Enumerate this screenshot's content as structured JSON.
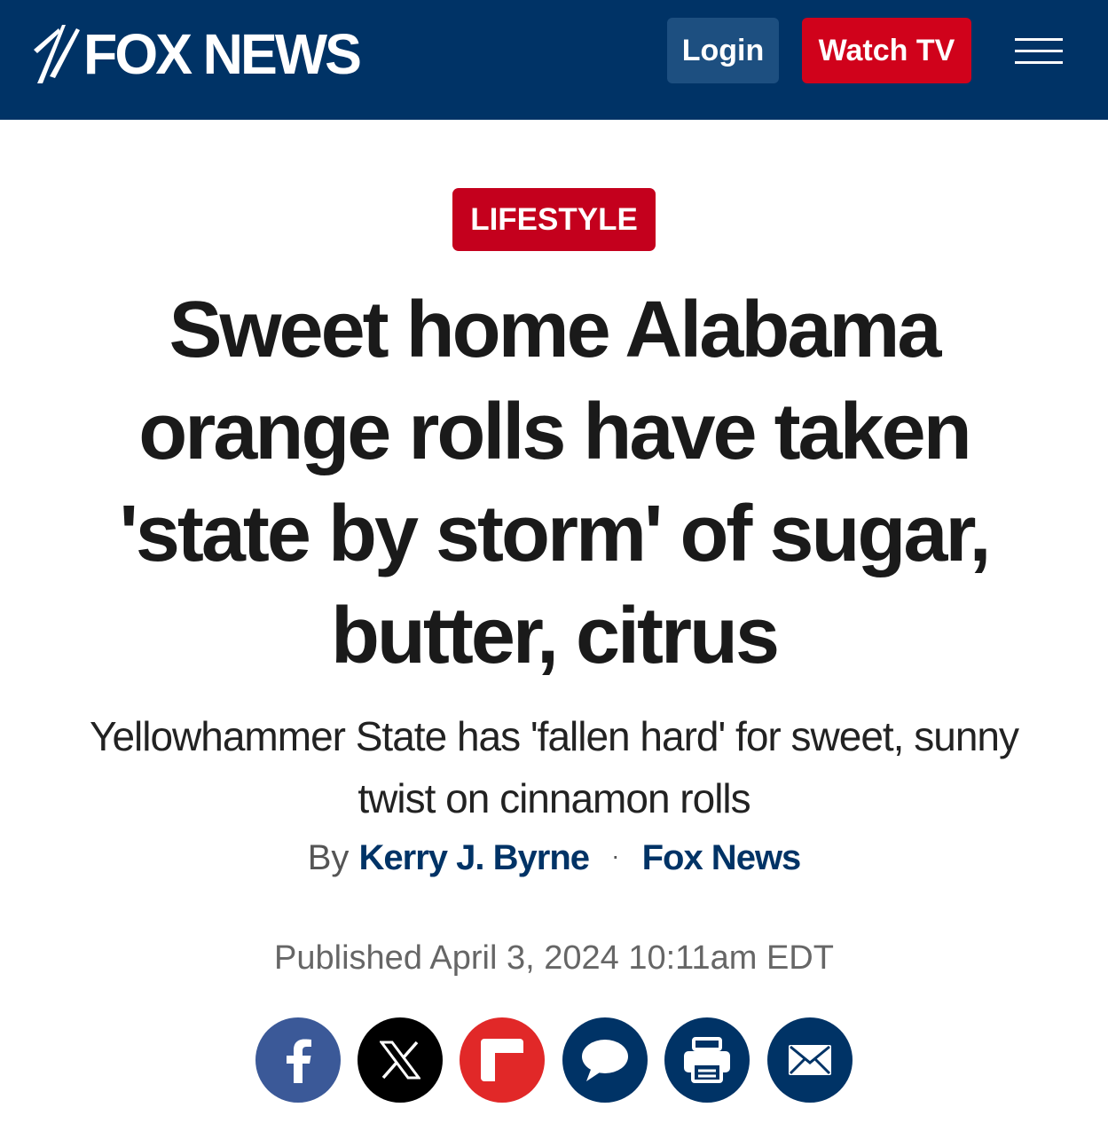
{
  "header": {
    "logo_text": "FOX NEWS",
    "login_label": "Login",
    "watch_label": "Watch TV",
    "colors": {
      "bar": "#003366",
      "login": "#1d4f80",
      "watch": "#d0021b"
    }
  },
  "article": {
    "category": "LIFESTYLE",
    "headline": "Sweet home Alabama orange rolls have taken 'state by storm' of sugar, butter, citrus",
    "subhead": "Yellowhammer State has 'fallen hard' for sweet, sunny twist on cinnamon rolls",
    "byline": {
      "prefix": "By",
      "author": "Kerry J. Byrne",
      "separator": "·",
      "outlet": "Fox News"
    },
    "published": "Published April 3, 2024 10:11am EDT"
  },
  "share": [
    {
      "name": "facebook",
      "icon": "facebook-icon",
      "color": "#3b5998"
    },
    {
      "name": "x",
      "icon": "x-icon",
      "color": "#000000"
    },
    {
      "name": "flipboard",
      "icon": "flipboard-icon",
      "color": "#e12828"
    },
    {
      "name": "comments",
      "icon": "comment-icon",
      "color": "#003366"
    },
    {
      "name": "print",
      "icon": "print-icon",
      "color": "#003366"
    },
    {
      "name": "email",
      "icon": "email-icon",
      "color": "#003366"
    }
  ]
}
